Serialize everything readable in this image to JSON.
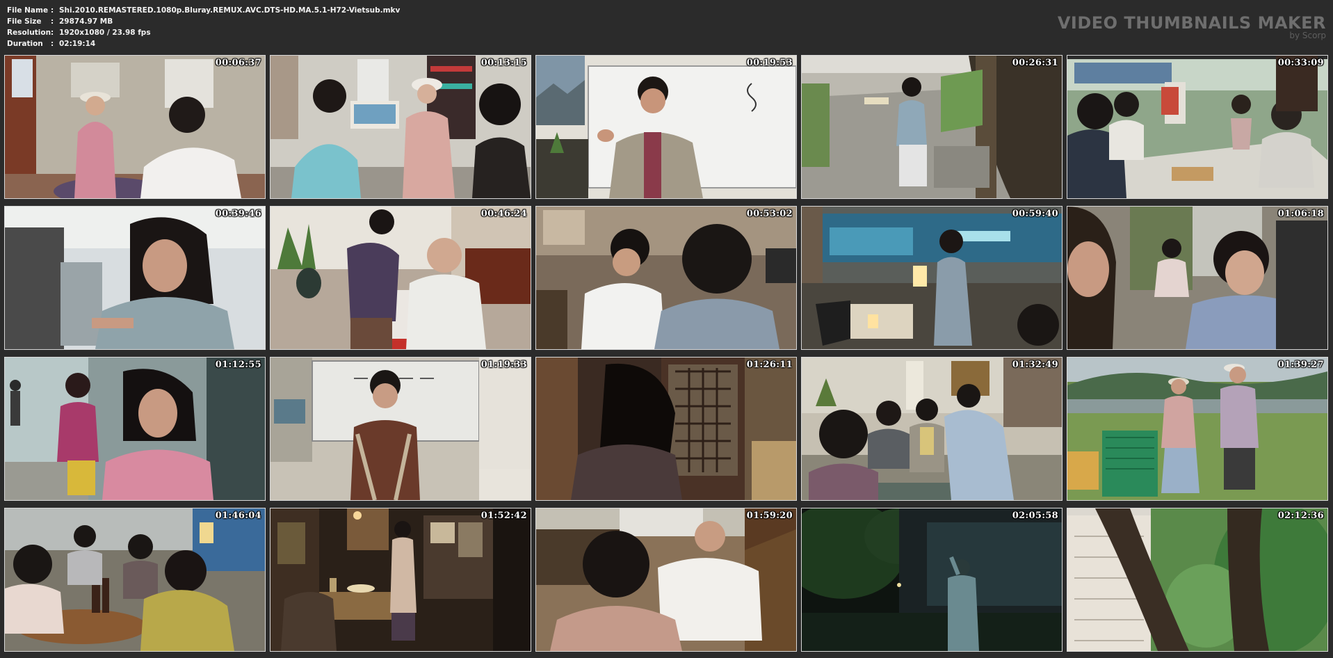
{
  "file_info": {
    "file_name_label": "File Name",
    "file_name": "Shi.2010.REMASTERED.1080p.Bluray.REMUX.AVC.DTS-HD.MA.5.1-H72-Vietsub.mkv",
    "file_size_label": "File Size",
    "file_size": "29874.97 MB",
    "resolution_label": "Resolution",
    "resolution": "1920x1080 / 23.98 fps",
    "duration_label": "Duration",
    "duration": "02:19:14",
    "separator": ":"
  },
  "brand": {
    "title": "VIDEO THUMBNAILS MAKER",
    "subtitle": "by Scorp"
  },
  "thumbnails": [
    {
      "timestamp": "00:06:37"
    },
    {
      "timestamp": "00:13:15"
    },
    {
      "timestamp": "00:19:53"
    },
    {
      "timestamp": "00:26:31"
    },
    {
      "timestamp": "00:33:09"
    },
    {
      "timestamp": "00:39:46"
    },
    {
      "timestamp": "00:46:24"
    },
    {
      "timestamp": "00:53:02"
    },
    {
      "timestamp": "00:59:40"
    },
    {
      "timestamp": "01:06:18"
    },
    {
      "timestamp": "01:12:55"
    },
    {
      "timestamp": "01:19:33"
    },
    {
      "timestamp": "01:26:11"
    },
    {
      "timestamp": "01:32:49"
    },
    {
      "timestamp": "01:39:27"
    },
    {
      "timestamp": "01:46:04"
    },
    {
      "timestamp": "01:52:42"
    },
    {
      "timestamp": "01:59:20"
    },
    {
      "timestamp": "02:05:58"
    },
    {
      "timestamp": "02:12:36"
    }
  ],
  "colors": {
    "background": "#2b2b2b",
    "text": "#f2f2f2",
    "brand": "#6e6e6e",
    "thumb_border": "#d8d8d8"
  }
}
